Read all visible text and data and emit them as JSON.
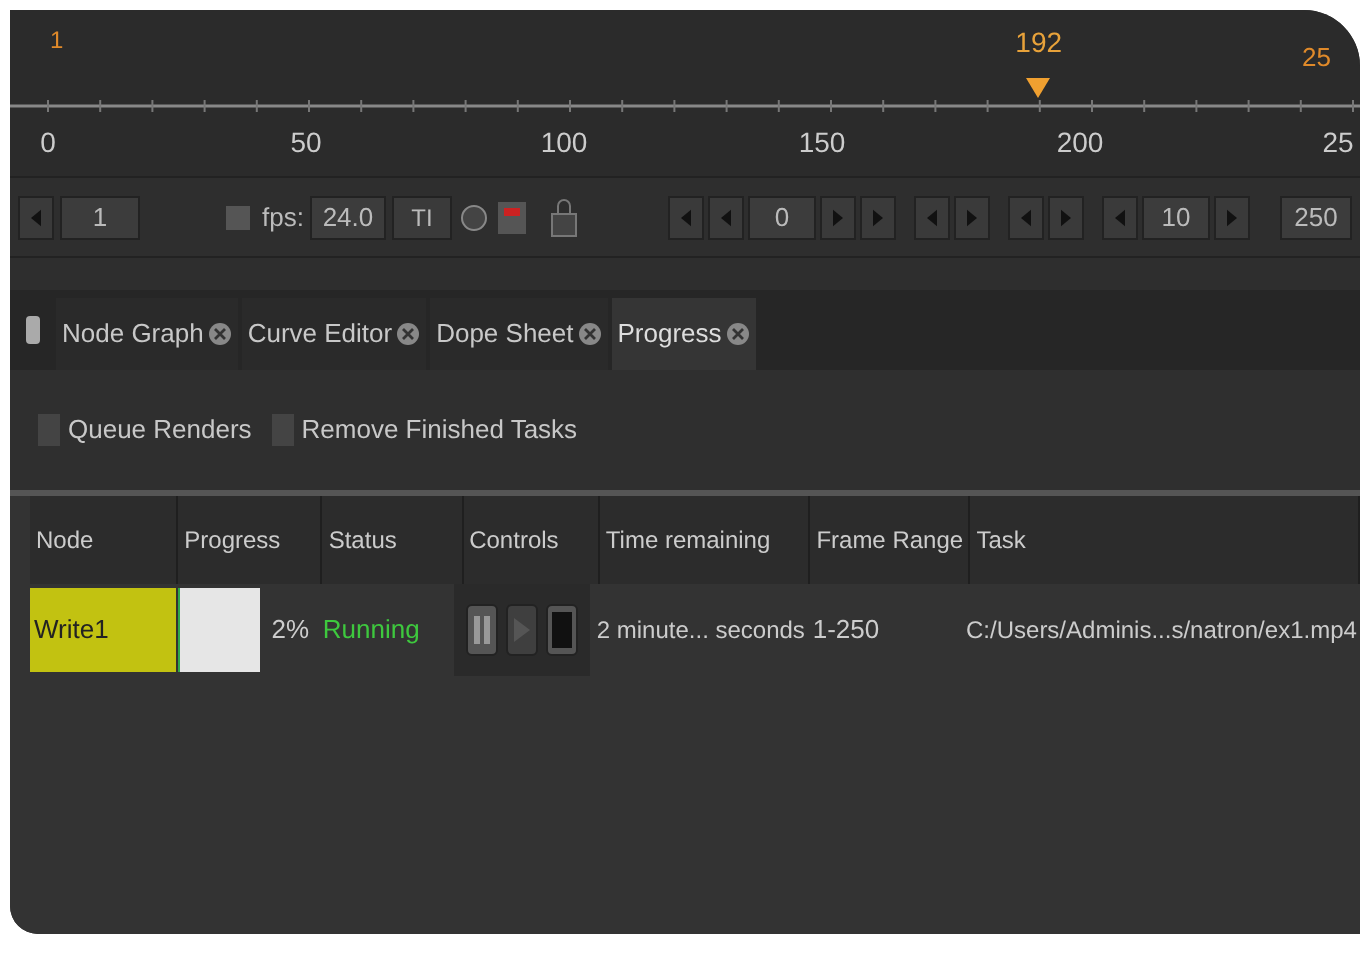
{
  "timeline": {
    "start_label": "1",
    "current_label": "192",
    "end_label": "25",
    "level": 0.768,
    "ticks": [
      "0",
      "50",
      "100",
      "150",
      "200",
      "25"
    ]
  },
  "controls": {
    "start_frame": "1",
    "fps_checked": false,
    "fps_label": "fps:",
    "fps": "24.0",
    "turbo": "TI",
    "frame": "0",
    "increment": "10",
    "end_frame": "250"
  },
  "tabs": [
    {
      "label": "Node Graph",
      "selected": false
    },
    {
      "label": "Curve Editor",
      "selected": false
    },
    {
      "label": "Dope Sheet",
      "selected": false
    },
    {
      "label": "Progress",
      "selected": true
    }
  ],
  "options": [
    {
      "label": "Queue Renders",
      "checked": false
    },
    {
      "label": "Remove Finished Tasks",
      "checked": false
    }
  ],
  "table": {
    "columns": [
      "Node",
      "Progress",
      "Status",
      "Controls",
      "Time remaining",
      "Frame Range",
      "Task"
    ],
    "rows": [
      {
        "node": "Write1",
        "level": 0.02,
        "percent": "2%",
        "status": "Running",
        "time_remaining": "2 minute... seconds",
        "frame_range": "1-250",
        "task": "C:/Users/Adminis...s/natron/ex1.mp4"
      }
    ]
  }
}
